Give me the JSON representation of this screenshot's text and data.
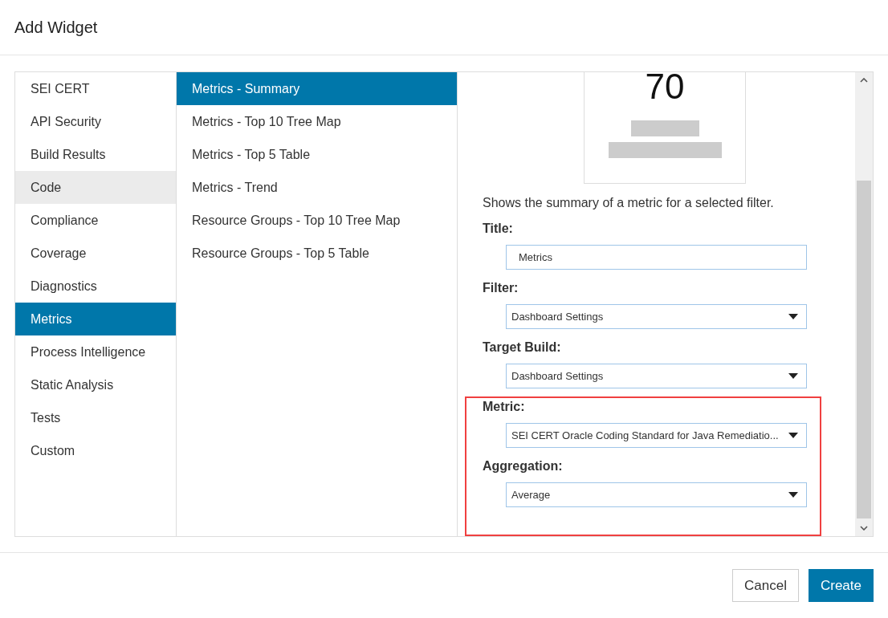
{
  "window": {
    "title": "Add Widget"
  },
  "categories": [
    {
      "label": "SEI CERT",
      "selected": false,
      "hovered": false
    },
    {
      "label": "API Security",
      "selected": false,
      "hovered": false
    },
    {
      "label": "Build Results",
      "selected": false,
      "hovered": false
    },
    {
      "label": "Code",
      "selected": false,
      "hovered": true
    },
    {
      "label": "Compliance",
      "selected": false,
      "hovered": false
    },
    {
      "label": "Coverage",
      "selected": false,
      "hovered": false
    },
    {
      "label": "Diagnostics",
      "selected": false,
      "hovered": false
    },
    {
      "label": "Metrics",
      "selected": true,
      "hovered": false
    },
    {
      "label": "Process Intelligence",
      "selected": false,
      "hovered": false
    },
    {
      "label": "Static Analysis",
      "selected": false,
      "hovered": false
    },
    {
      "label": "Tests",
      "selected": false,
      "hovered": false
    },
    {
      "label": "Custom",
      "selected": false,
      "hovered": false
    }
  ],
  "widgets": [
    {
      "label": "Metrics - Summary",
      "selected": true
    },
    {
      "label": "Metrics - Top 10 Tree Map",
      "selected": false
    },
    {
      "label": "Metrics - Top 5 Table",
      "selected": false
    },
    {
      "label": "Metrics - Trend",
      "selected": false
    },
    {
      "label": "Resource Groups - Top 10 Tree Map",
      "selected": false
    },
    {
      "label": "Resource Groups - Top 5 Table",
      "selected": false
    }
  ],
  "preview": {
    "value": "70"
  },
  "description": "Shows the summary of a metric for a selected filter.",
  "fields": [
    {
      "kind": "text",
      "label": "Title:",
      "value": "Metrics",
      "highlighted": false
    },
    {
      "kind": "select",
      "label": "Filter:",
      "value": "Dashboard Settings",
      "highlighted": false
    },
    {
      "kind": "select",
      "label": "Target Build:",
      "value": "Dashboard Settings",
      "highlighted": false
    },
    {
      "kind": "select",
      "label": "Metric:",
      "value": "SEI CERT Oracle Coding Standard for Java Remediatio...",
      "highlighted": true
    },
    {
      "kind": "select",
      "label": "Aggregation:",
      "value": "Average",
      "highlighted": true
    }
  ],
  "buttons": [
    {
      "label": "Cancel",
      "kind": "secondary"
    },
    {
      "label": "Create",
      "kind": "primary"
    }
  ]
}
